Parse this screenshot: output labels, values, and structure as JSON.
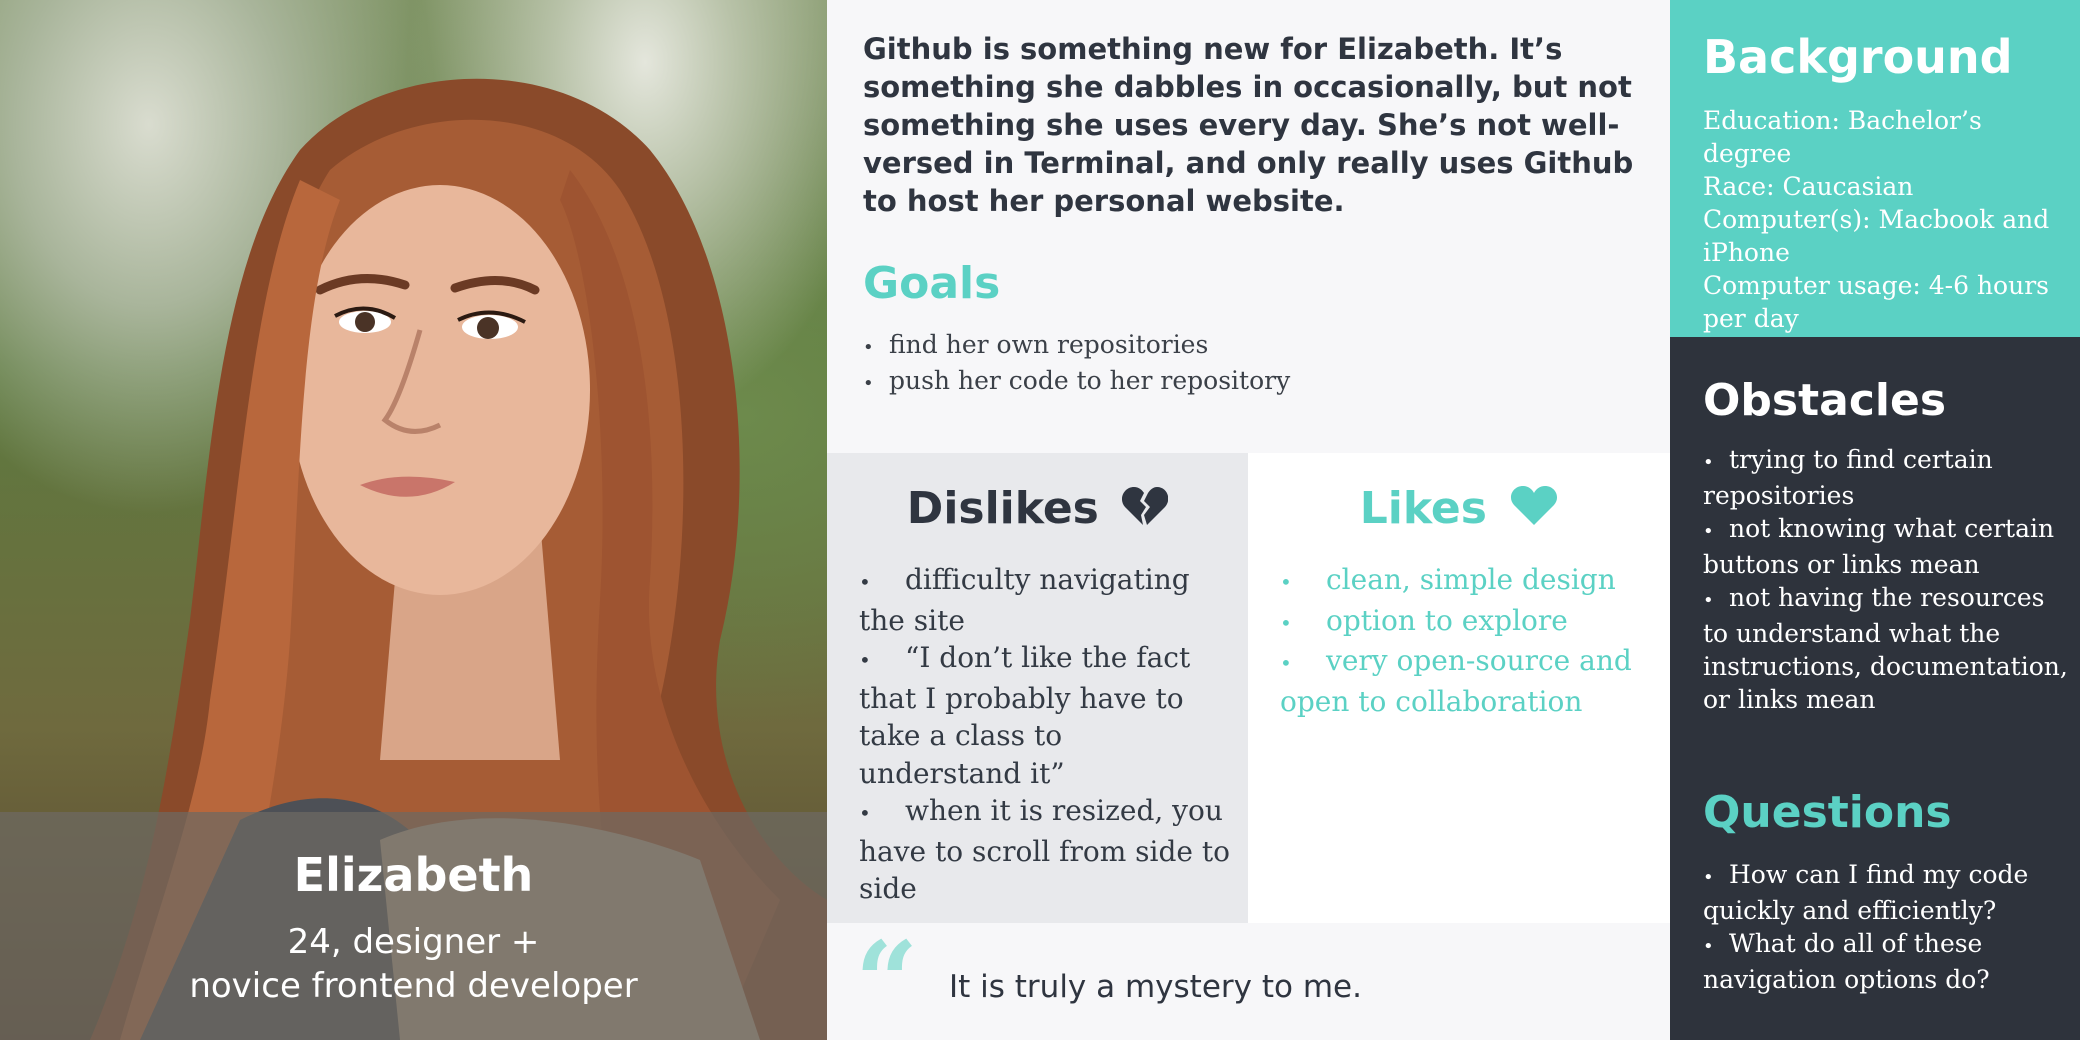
{
  "persona": {
    "photo_icon": "portrait-photo",
    "name": "Elizabeth",
    "subtitle_line1": "24, designer +",
    "subtitle_line2": "novice frontend developer"
  },
  "intro": {
    "text": "Github is something new for Elizabeth. It’s something she dabbles in occasionally, but not something she uses every day. She’s not well-versed in Terminal, and only really uses Github to host her personal website."
  },
  "goals": {
    "title": "Goals",
    "items": [
      "find her own repositories",
      "push her code to her repository"
    ]
  },
  "dislikes": {
    "title": "Dislikes",
    "icon": "broken-heart-icon",
    "items": [
      "difficulty navigating the site",
      "“I don’t like the fact that I probably have to take a class to understand it”",
      "when it is resized, you have to scroll from side to side"
    ]
  },
  "likes": {
    "title": "Likes",
    "icon": "heart-icon",
    "items": [
      "clean, simple design",
      "option to explore",
      "very open-source and open to collaboration"
    ]
  },
  "quote": {
    "mark": "“",
    "text": "It is truly a mystery to me."
  },
  "background": {
    "title": "Background",
    "lines": [
      "Education: Bachelor’s degree",
      "Race: Caucasian",
      "Computer(s): Macbook and iPhone",
      "Computer usage: 4-6 hours per day"
    ]
  },
  "obstacles": {
    "title": "Obstacles",
    "items": [
      "trying to find certain repositories",
      "not knowing what certain buttons or links mean",
      "not having the resources to understand what the instructions, documentation, or links mean"
    ]
  },
  "questions": {
    "title": "Questions",
    "items": [
      "How can I find my code quickly and efficiently?",
      "What do all of these navigation options do?"
    ]
  },
  "colors": {
    "accent": "#5bd1c4",
    "dark": "#2e333c",
    "light_panel": "#f7f7f9",
    "grey_panel": "#e8e9ec"
  }
}
